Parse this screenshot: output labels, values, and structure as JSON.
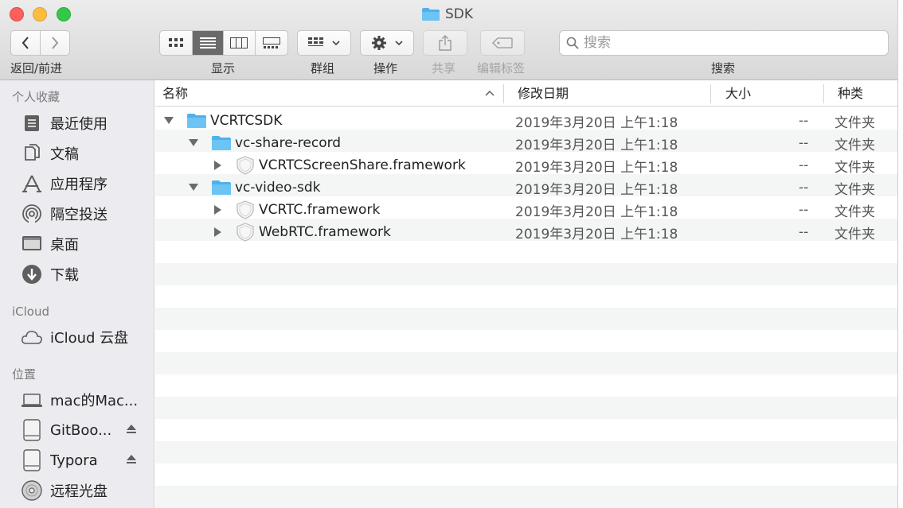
{
  "window": {
    "title": "SDK"
  },
  "toolbar": {
    "nav_label": "返回/前进",
    "display_label": "显示",
    "group_label": "群组",
    "action_label": "操作",
    "share_label": "共享",
    "tags_label": "编辑标签",
    "search_label": "搜索",
    "search_placeholder": "搜索"
  },
  "sidebar": {
    "favorites_header": "个人收藏",
    "favorites": [
      {
        "label": "最近使用",
        "icon": "recents-icon"
      },
      {
        "label": "文稿",
        "icon": "documents-icon"
      },
      {
        "label": "应用程序",
        "icon": "applications-icon"
      },
      {
        "label": "隔空投送",
        "icon": "airdrop-icon"
      },
      {
        "label": "桌面",
        "icon": "desktop-icon"
      },
      {
        "label": "下载",
        "icon": "downloads-icon"
      }
    ],
    "icloud_header": "iCloud",
    "icloud": [
      {
        "label": "iCloud 云盘",
        "icon": "cloud-icon"
      }
    ],
    "locations_header": "位置",
    "locations": [
      {
        "label": "mac的Mac...",
        "icon": "laptop-icon"
      },
      {
        "label": "GitBoo...",
        "icon": "disk-icon",
        "eject": true
      },
      {
        "label": "Typora",
        "icon": "disk-icon",
        "eject": true
      },
      {
        "label": "远程光盘",
        "icon": "optical-disc-icon"
      }
    ]
  },
  "columns": {
    "name": "名称",
    "modified": "修改日期",
    "size": "大小",
    "kind": "种类"
  },
  "files": [
    {
      "name": "VCRTCSDK",
      "type": "folder",
      "expanded": true,
      "depth": 0,
      "date": "2019年3月20日 上午1:18",
      "size": "--",
      "kind": "文件夹"
    },
    {
      "name": "vc-share-record",
      "type": "folder",
      "expanded": true,
      "depth": 1,
      "date": "2019年3月20日 上午1:18",
      "size": "--",
      "kind": "文件夹"
    },
    {
      "name": "VCRTCScreenShare.framework",
      "type": "framework",
      "expanded": false,
      "depth": 2,
      "date": "2019年3月20日 上午1:18",
      "size": "--",
      "kind": "文件夹"
    },
    {
      "name": "vc-video-sdk",
      "type": "folder",
      "expanded": true,
      "depth": 1,
      "date": "2019年3月20日 上午1:18",
      "size": "--",
      "kind": "文件夹"
    },
    {
      "name": "VCRTC.framework",
      "type": "framework",
      "expanded": false,
      "depth": 2,
      "date": "2019年3月20日 上午1:18",
      "size": "--",
      "kind": "文件夹"
    },
    {
      "name": "WebRTC.framework",
      "type": "framework",
      "expanded": false,
      "depth": 2,
      "date": "2019年3月20日 上午1:18",
      "size": "--",
      "kind": "文件夹"
    }
  ],
  "colors": {
    "folder": "#6cc4f5",
    "folder_tab": "#4fb1ea",
    "sidebar_icon": "#5f5f5f"
  }
}
